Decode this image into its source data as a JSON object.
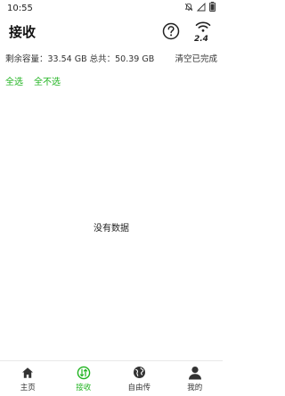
{
  "status_bar": {
    "time": "10:55",
    "icons": [
      "notification-muted-icon",
      "signal-empty-icon",
      "battery-icon"
    ]
  },
  "app_bar": {
    "title": "接收",
    "help_icon": "help-circle-icon",
    "wifi_icon": "wifi-icon",
    "wifi_band": "2.4"
  },
  "storage": {
    "summary": "剩余容量：33.54 GB 总共：50.39 GB",
    "clear_completed_label": "清空已完成"
  },
  "selection": {
    "select_all_label": "全选",
    "select_none_label": "全不选"
  },
  "empty_state": {
    "message": "没有数据"
  },
  "bottom_nav": {
    "items": [
      {
        "label": "主页",
        "icon": "home-icon",
        "active": false
      },
      {
        "label": "接收",
        "icon": "receive-icon",
        "active": true
      },
      {
        "label": "自由传",
        "icon": "globe-icon",
        "active": false
      },
      {
        "label": "我的",
        "icon": "profile-icon",
        "active": false
      }
    ]
  },
  "colors": {
    "accent": "#1fb31f",
    "text": "#222222",
    "background": "#ffffff"
  }
}
